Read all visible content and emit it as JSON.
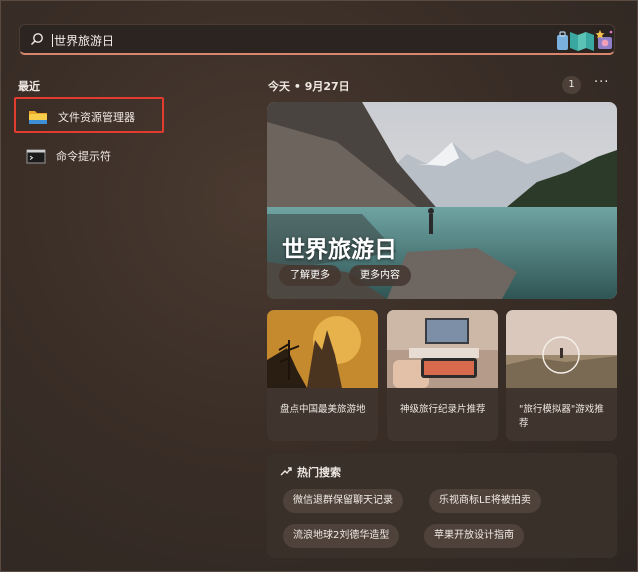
{
  "search": {
    "value": "世界旅游日"
  },
  "recent": {
    "title": "最近",
    "items": [
      {
        "label": "文件资源管理器",
        "icon": "folder-icon",
        "selected": true
      },
      {
        "label": "命令提示符",
        "icon": "terminal-icon",
        "selected": false
      }
    ]
  },
  "header": {
    "today": "今天 • 9月27日",
    "badge": "1",
    "more": "···"
  },
  "hero": {
    "title": "世界旅游日",
    "buttons": [
      "了解更多",
      "更多内容"
    ]
  },
  "cards": [
    {
      "text": "盘点中国最美旅游地"
    },
    {
      "text": "神级旅行纪录片推荐"
    },
    {
      "text": "\"旅行模拟器\"游戏推荐"
    }
  ],
  "hot": {
    "title": "热门搜索",
    "chips": [
      "微信退群保留聊天记录",
      "乐视商标LE将被拍卖",
      "流浪地球2刘德华造型",
      "苹果开放设计指南"
    ]
  },
  "colors": {
    "accent": "#d9866f",
    "highlight": "#e23c2f",
    "background": "#3a2e27"
  }
}
